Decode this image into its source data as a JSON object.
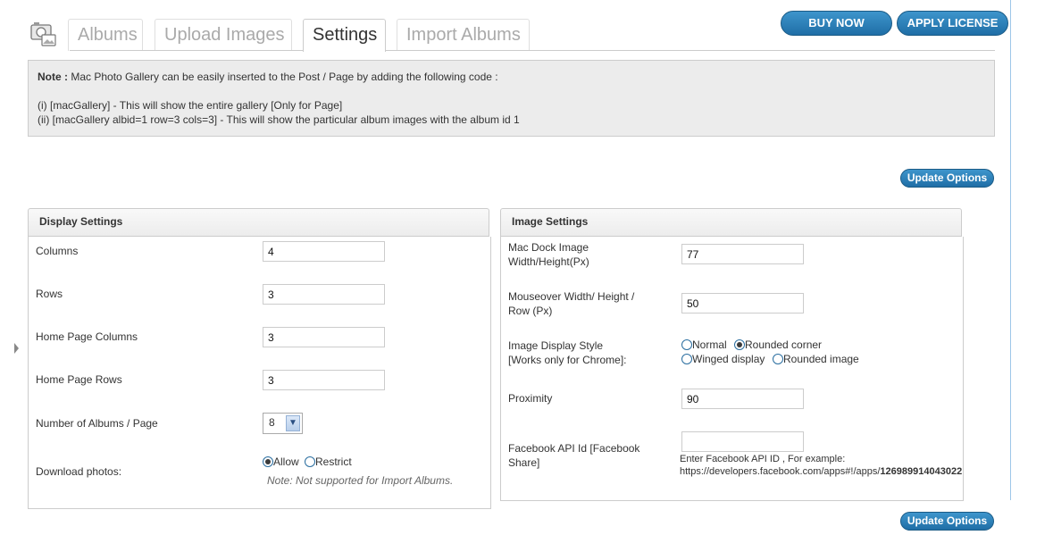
{
  "tabs": [
    {
      "label": "Albums"
    },
    {
      "label": "Upload Images"
    },
    {
      "label": "Settings"
    },
    {
      "label": "Import Albums"
    }
  ],
  "header_buttons": {
    "buy_now": "BUY NOW",
    "apply_license": "APPLY LICENSE"
  },
  "note": {
    "prefix": "Note :",
    "text": " Mac Photo Gallery can be easily inserted to the Post / Page by adding the following code :",
    "line1": "(i) [macGallery] - This will show the entire gallery [Only for Page]",
    "line2": "(ii) [macGallery albid=1 row=3 cols=3] - This will show the particular album images with the album id 1"
  },
  "update_options": "Update Options",
  "display_settings": {
    "title": "Display Settings",
    "columns_label": "Columns",
    "columns_value": "4",
    "rows_label": "Rows",
    "rows_value": "3",
    "home_columns_label": "Home Page Columns",
    "home_columns_value": "3",
    "home_rows_label": "Home Page Rows",
    "home_rows_value": "3",
    "albums_per_page_label": "Number of Albums / Page",
    "albums_per_page_value": "8",
    "download_label": "Download photos:",
    "download_options": [
      "Allow",
      "Restrict"
    ],
    "download_selected": "Allow",
    "download_note": "Note: Not supported for Import Albums."
  },
  "image_settings": {
    "title": "Image Settings",
    "dock_label_1": "Mac Dock Image",
    "dock_label_2": "Width/Height(Px)",
    "dock_value": "77",
    "mouseover_label_1": "Mouseover Width/ Height /",
    "mouseover_label_2": "Row (Px)",
    "mouseover_value": "50",
    "style_label_1": "Image Display Style",
    "style_label_2": "[Works only for Chrome]:",
    "style_options": [
      "Normal",
      "Rounded corner",
      "Winged display",
      "Rounded image"
    ],
    "style_selected": "Rounded corner",
    "proximity_label": "Proximity",
    "proximity_value": "90",
    "fb_label_1": "Facebook API Id [Facebook",
    "fb_label_2": "Share]",
    "fb_value": "",
    "fb_help_1": "Enter Facebook API ID , For example:",
    "fb_help_2": "https://developers.facebook.com/apps#!/apps/",
    "fb_help_id": "126989914043022"
  },
  "colors": {
    "button": "#2a7bb5",
    "note_bg": "#ececec"
  }
}
